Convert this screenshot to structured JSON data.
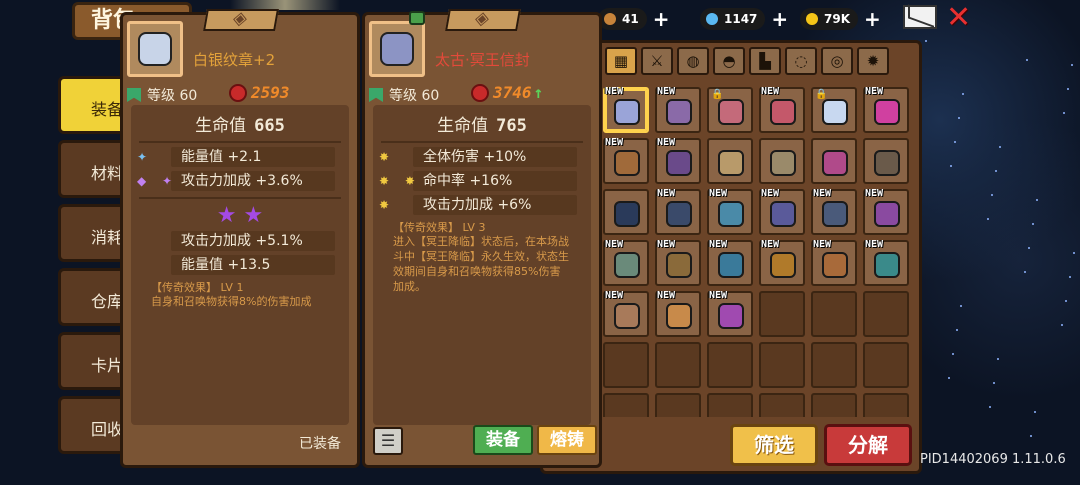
{
  "window": {
    "title": "背包"
  },
  "sidebar": {
    "tabs": [
      {
        "label": "装备",
        "active": true
      },
      {
        "label": "材料",
        "active": false
      },
      {
        "label": "消耗",
        "active": false
      },
      {
        "label": "仓库",
        "active": false
      },
      {
        "label": "卡片",
        "active": false
      },
      {
        "label": "回收",
        "active": false
      }
    ]
  },
  "currency": [
    {
      "name": "ticket-icon",
      "value": "41",
      "color": "#c8843a"
    },
    {
      "name": "diamond-icon",
      "value": "1147",
      "color": "#5ab8f0"
    },
    {
      "name": "gold-coin-icon",
      "value": "79K",
      "color": "#f5c518"
    }
  ],
  "filters": [
    {
      "icon": "all-grid-icon",
      "glyph": "▦",
      "active": true
    },
    {
      "icon": "weapon-icon",
      "glyph": "⚔",
      "active": false
    },
    {
      "icon": "armor-icon",
      "glyph": "◍",
      "active": false
    },
    {
      "icon": "helmet-icon",
      "glyph": "◓",
      "active": false
    },
    {
      "icon": "boots-icon",
      "glyph": "▙",
      "active": false
    },
    {
      "icon": "ring-icon",
      "glyph": "◌",
      "active": false
    },
    {
      "icon": "amulet-icon",
      "glyph": "◎",
      "active": false
    },
    {
      "icon": "settings-gear-icon",
      "glyph": "✹",
      "active": false
    }
  ],
  "inventory": [
    {
      "color": "#9aa4d8",
      "new": true,
      "selected": true
    },
    {
      "color": "#8a6aa8",
      "new": true
    },
    {
      "color": "#c46a7a",
      "new": false,
      "lock": true
    },
    {
      "color": "#c4586a",
      "new": true
    },
    {
      "color": "#c8d8f0",
      "new": false,
      "lock": true
    },
    {
      "color": "#d040a0",
      "new": true
    },
    {
      "color": "#a06a3a",
      "new": true
    },
    {
      "color": "#6a4a8a",
      "new": true
    },
    {
      "color": "#b89a6a",
      "new": false
    },
    {
      "color": "#9a8a6a",
      "new": false
    },
    {
      "color": "#b04a8a",
      "new": false
    },
    {
      "color": "#6a5a4a",
      "new": false
    },
    {
      "color": "#2a3a5a",
      "new": false
    },
    {
      "color": "#3a4a6a",
      "new": true
    },
    {
      "color": "#4a8aa8",
      "new": true
    },
    {
      "color": "#5a5a9a",
      "new": true
    },
    {
      "color": "#4a5a7a",
      "new": true
    },
    {
      "color": "#8a4aa0",
      "new": true
    },
    {
      "color": "#6a8a7a",
      "new": true
    },
    {
      "color": "#8a6a3a",
      "new": true
    },
    {
      "color": "#3a7a9a",
      "new": true
    },
    {
      "color": "#b07a2a",
      "new": true
    },
    {
      "color": "#a86a3a",
      "new": true
    },
    {
      "color": "#3a8a8a",
      "new": true
    },
    {
      "color": "#a87a5a",
      "new": true
    },
    {
      "color": "#c88a4a",
      "new": true
    },
    {
      "color": "#a04ab0",
      "new": true
    },
    {
      "color": null
    },
    {
      "color": null
    },
    {
      "color": null
    },
    {
      "color": null
    },
    {
      "color": null
    },
    {
      "color": null
    },
    {
      "color": null
    },
    {
      "color": null
    },
    {
      "color": null
    },
    {
      "color": null
    },
    {
      "color": null
    },
    {
      "color": null
    },
    {
      "color": null
    },
    {
      "color": null
    },
    {
      "color": null
    }
  ],
  "new_label": "NEW",
  "actions": {
    "filter": "筛选",
    "decompose": "分解"
  },
  "card_equipped": {
    "name": "白银纹章+2",
    "level": "等级 60",
    "power": "2593",
    "hp_label": "生命值",
    "hp_value": "665",
    "stats": [
      {
        "icon": "✦",
        "text": "能量值 +2.1"
      },
      {
        "icon": "◆ ✦",
        "text": "攻击力加成 +3.6%"
      }
    ],
    "gems": "★ ★",
    "extra_stats": [
      {
        "text": "攻击力加成 +5.1%"
      },
      {
        "text": "能量值 +13.5"
      }
    ],
    "legend_title": "【传奇效果】 LV 1",
    "legend_text": "自身和召唤物获得8%的伤害加成",
    "status": "已装备"
  },
  "card_selected": {
    "name": "太古·冥王信封",
    "level": "等级 60",
    "power": "3746",
    "hp_label": "生命值",
    "hp_value": "765",
    "stats": [
      {
        "icon": "✸",
        "text": "全体伤害 +10%"
      },
      {
        "icon": "✸ ✸",
        "text": "命中率 +16%"
      },
      {
        "icon": "✸",
        "text": "攻击力加成 +6%"
      }
    ],
    "legend_title": "【传奇效果】 LV 3",
    "legend_text": "进入【冥王降临】状态后，在本场战斗中【冥王降临】永久生效，状态生效期间自身和召唤物获得85%伤害加成。",
    "equip_label": "装备",
    "forge_label": "熔铸"
  },
  "version": "PID14402069 1.11.0.6"
}
